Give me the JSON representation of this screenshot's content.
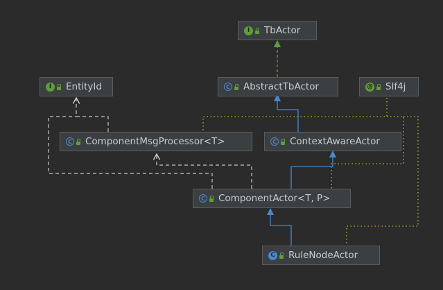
{
  "nodes": {
    "tbactor": {
      "label": "TbActor",
      "kind": "interface",
      "badge": "I"
    },
    "abstracttbactor": {
      "label": "AbstractTbActor",
      "kind": "abstract",
      "badge": "C"
    },
    "slf4j": {
      "label": "Slf4j",
      "kind": "annotation",
      "badge": "@"
    },
    "entityid": {
      "label": "EntityId",
      "kind": "interface",
      "badge": "I"
    },
    "componentmsgprocessor": {
      "label": "ComponentMsgProcessor<T>",
      "kind": "abstract",
      "badge": "C"
    },
    "contextawareactor": {
      "label": "ContextAwareActor",
      "kind": "abstract",
      "badge": "C"
    },
    "componentactor": {
      "label": "ComponentActor<T, P>",
      "kind": "abstract",
      "badge": "C"
    },
    "rulenodeactor": {
      "label": "RuleNodeActor",
      "kind": "class",
      "badge": "C"
    }
  },
  "colors": {
    "background": "#2b2b2b",
    "implements": "#5e9e3a",
    "extends": "#4a88c7",
    "dependency": "#c8c8c8",
    "annotation": "#a3a31a"
  }
}
